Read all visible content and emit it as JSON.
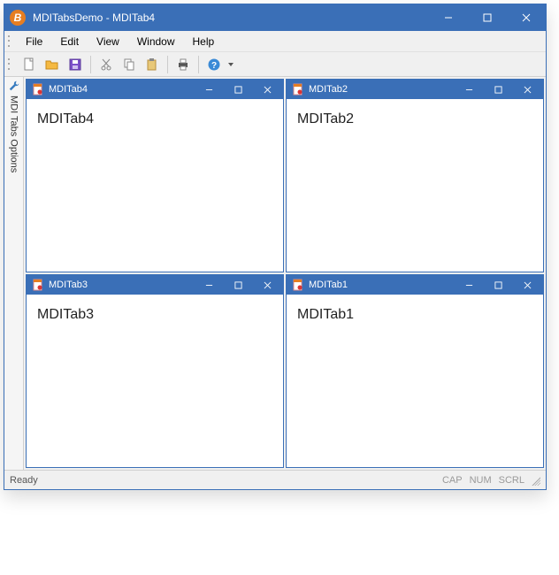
{
  "titlebar": {
    "title": "MDITabsDemo - MDITab4"
  },
  "menus": {
    "file": "File",
    "edit": "Edit",
    "view": "View",
    "window": "Window",
    "help": "Help"
  },
  "toolbar": {
    "new": "new-file-icon",
    "open": "open-folder-icon",
    "save": "save-icon",
    "cut": "cut-icon",
    "copy": "copy-icon",
    "paste": "paste-icon",
    "print": "print-icon",
    "help": "help-icon"
  },
  "sidepanel": {
    "label": "MDI Tabs Options"
  },
  "children": [
    {
      "title": "MDITab4",
      "content": "MDITab4"
    },
    {
      "title": "MDITab2",
      "content": "MDITab2"
    },
    {
      "title": "MDITab3",
      "content": "MDITab3"
    },
    {
      "title": "MDITab1",
      "content": "MDITab1"
    }
  ],
  "statusbar": {
    "status": "Ready",
    "cap": "CAP",
    "num": "NUM",
    "scrl": "SCRL"
  },
  "colors": {
    "accent": "#3a6fb7"
  }
}
